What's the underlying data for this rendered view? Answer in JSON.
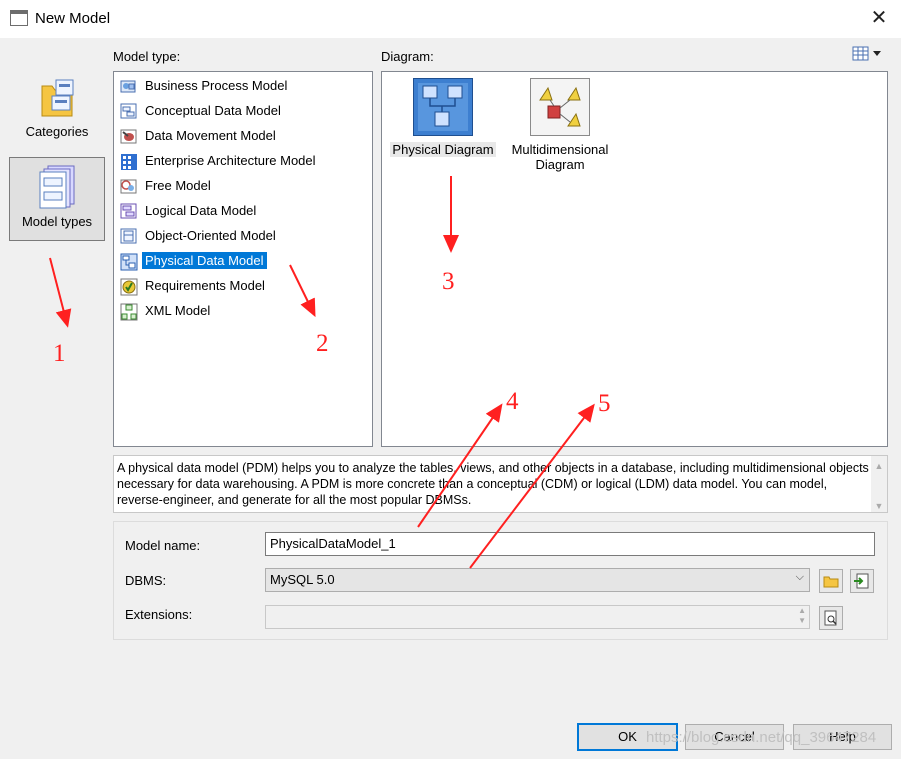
{
  "window": {
    "title": "New Model",
    "close_symbol": "✕"
  },
  "sidebar": {
    "categories_label": "Categories",
    "model_types_label": "Model types"
  },
  "model_type": {
    "label": "Model type:",
    "items": [
      {
        "label": "Business Process Model",
        "icon": "business-process-icon"
      },
      {
        "label": "Conceptual Data Model",
        "icon": "conceptual-data-icon"
      },
      {
        "label": "Data Movement Model",
        "icon": "data-movement-icon"
      },
      {
        "label": "Enterprise Architecture Model",
        "icon": "enterprise-architecture-icon"
      },
      {
        "label": "Free Model",
        "icon": "free-model-icon"
      },
      {
        "label": "Logical Data Model",
        "icon": "logical-data-icon"
      },
      {
        "label": "Object-Oriented Model",
        "icon": "object-oriented-icon"
      },
      {
        "label": "Physical Data Model",
        "icon": "physical-data-icon",
        "selected": true
      },
      {
        "label": "Requirements Model",
        "icon": "requirements-icon"
      },
      {
        "label": "XML Model",
        "icon": "xml-model-icon"
      }
    ]
  },
  "diagram": {
    "label": "Diagram:",
    "items": [
      {
        "label": "Physical Diagram",
        "icon": "physical-diagram-icon",
        "selected": true
      },
      {
        "label_line1": "Multidimensional",
        "label_line2": "Diagram",
        "icon": "multidimensional-diagram-icon"
      }
    ]
  },
  "description": "A physical data model (PDM) helps you to analyze the tables, views, and other objects in a database, including multidimensional objects necessary for data warehousing. A PDM is more concrete than a conceptual (CDM) or logical (LDM) data model. You can model, reverse-engineer, and generate for all the most popular DBMSs.",
  "form": {
    "model_name_label": "Model name:",
    "model_name_value": "PhysicalDataModel_1",
    "dbms_label": "DBMS:",
    "dbms_value": "MySQL 5.0",
    "extensions_label": "Extensions:",
    "extensions_value": ""
  },
  "buttons": {
    "ok": "OK",
    "cancel": "Cancel",
    "help": "Help"
  },
  "annotations": [
    "1",
    "2",
    "3",
    "4",
    "5"
  ],
  "watermark": "https://blog.csdn.net/qq_39647284",
  "colors": {
    "selection": "#0078d7",
    "annotation": "#ff2020"
  }
}
